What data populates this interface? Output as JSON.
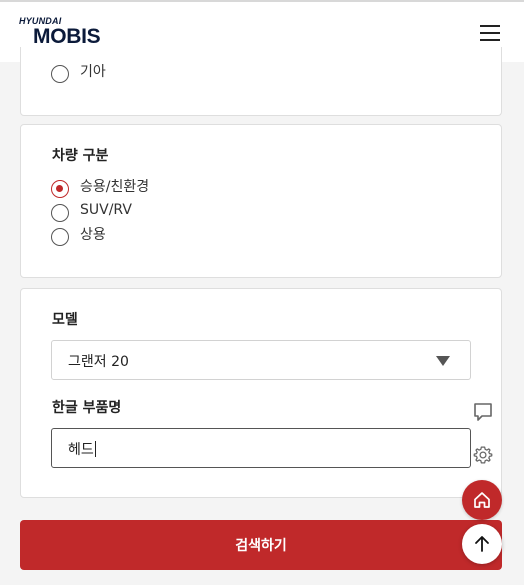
{
  "header": {
    "brand_top": "HYUNDAI",
    "brand_main": "MOBIS",
    "menu_icon": "hamburger-menu-icon"
  },
  "maker_section": {
    "options": [
      {
        "label": "기아",
        "checked": false
      }
    ]
  },
  "vehicle_type_section": {
    "title": "차량 구분",
    "options": [
      {
        "label": "승용/친환경",
        "checked": true
      },
      {
        "label": "SUV/RV",
        "checked": false
      },
      {
        "label": "상용",
        "checked": false
      }
    ]
  },
  "model_section": {
    "title": "모델",
    "selected": "그랜저 20"
  },
  "part_name_section": {
    "title": "한글 부품명",
    "value": "헤드"
  },
  "search_button": {
    "label": "검색하기"
  },
  "floating": {
    "chat_icon": "chat-bubble-icon",
    "settings_icon": "gear-icon",
    "home_icon": "home-icon",
    "top_icon": "arrow-up-icon"
  },
  "colors": {
    "accent": "#c0292a",
    "brand": "#0b1a3a",
    "background": "#f4f4f4"
  }
}
